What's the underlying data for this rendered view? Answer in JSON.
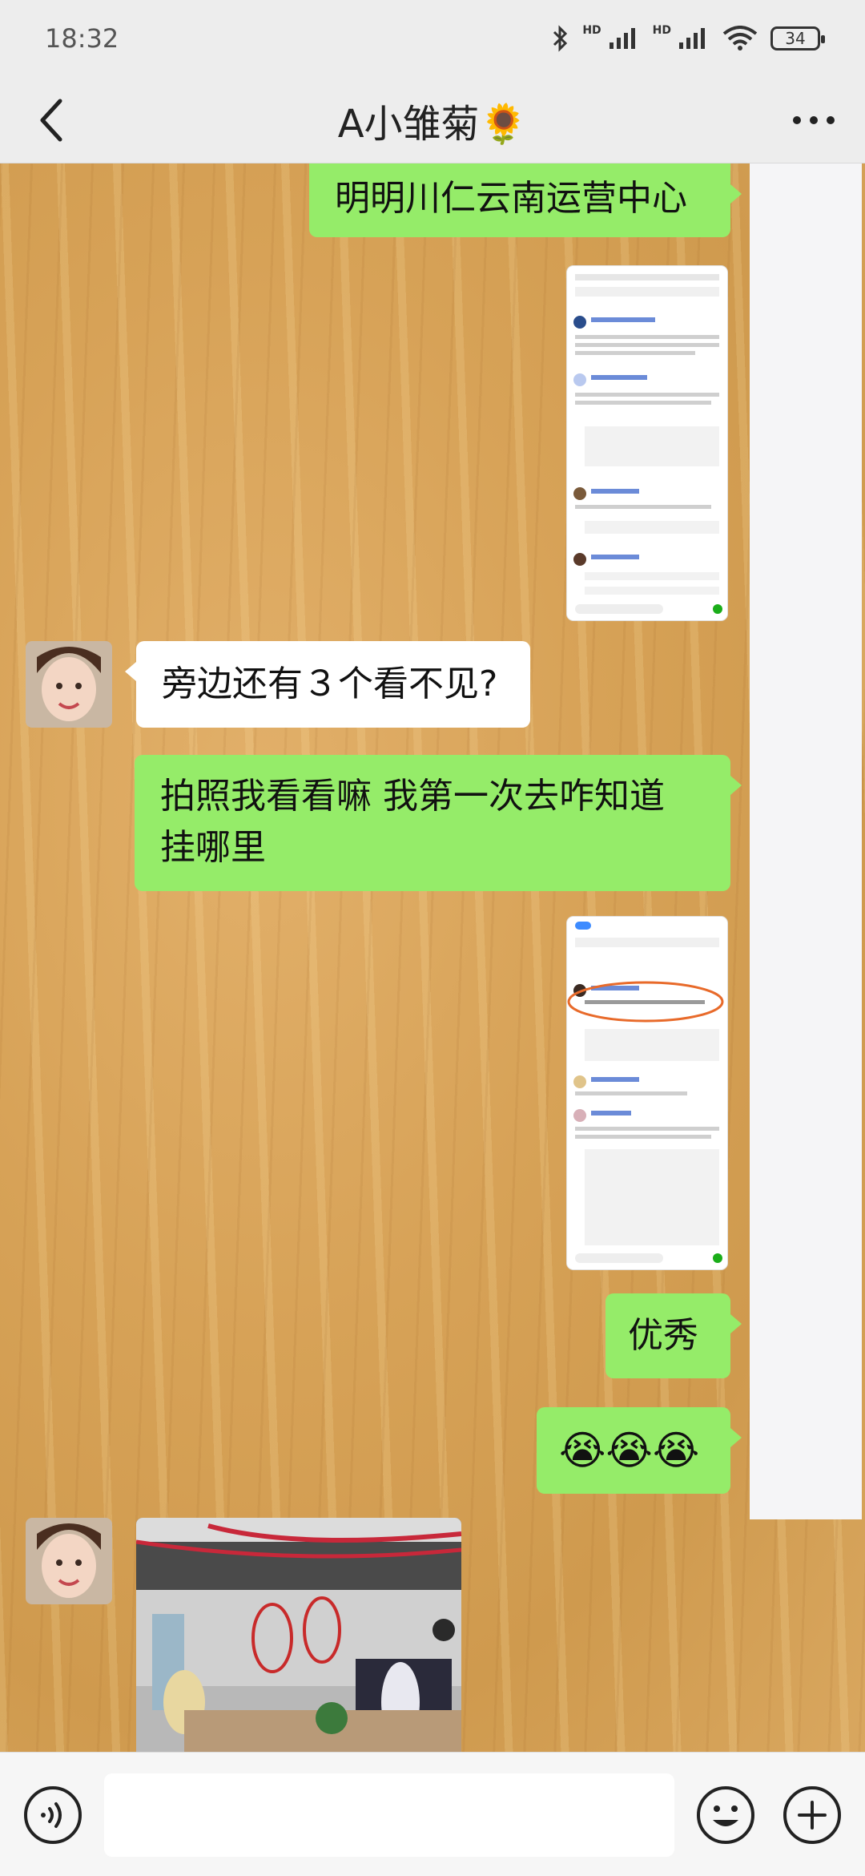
{
  "status_bar": {
    "time": "18:32",
    "hd1": "HD",
    "hd2": "HD",
    "battery": "34"
  },
  "header": {
    "title": "A小雏菊🌻"
  },
  "messages": [
    {
      "from": "me",
      "type": "text",
      "text": "明明川仁云南运营中心"
    },
    {
      "from": "me",
      "type": "image",
      "icon": "screenshot-thumbnail"
    },
    {
      "from": "contact",
      "type": "text",
      "text": "旁边还有３个看不见?"
    },
    {
      "from": "me",
      "type": "text",
      "lines": [
        "拍照我看看嘛  我第一次去咋知道",
        "挂哪里"
      ]
    },
    {
      "from": "me",
      "type": "image",
      "icon": "screenshot-thumbnail-annotated"
    },
    {
      "from": "me",
      "type": "text",
      "text": "优秀"
    },
    {
      "from": "me",
      "type": "text",
      "text": "😭😭😭"
    },
    {
      "from": "contact",
      "type": "image",
      "icon": "office-photo"
    }
  ],
  "input_bar": {
    "placeholder": ""
  },
  "colors": {
    "sent_bubble": "#95ec69",
    "received_bubble": "#ffffff",
    "bar_background": "#ededed"
  }
}
